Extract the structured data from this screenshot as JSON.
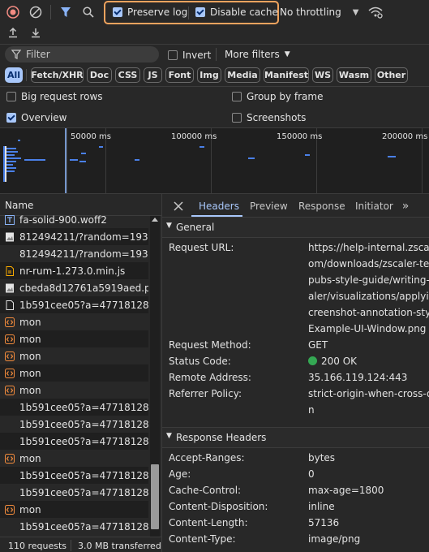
{
  "toolbar": {
    "preserve_log": {
      "label": "Preserve log",
      "checked": true
    },
    "disable_cache": {
      "label": "Disable cache",
      "checked": true
    },
    "throttling": "No throttling",
    "highlight_color": "#f0a35e"
  },
  "filter": {
    "placeholder": "Filter",
    "invert_label": "Invert",
    "more_filters_label": "More filters",
    "types": [
      "All",
      "Fetch/XHR",
      "Doc",
      "CSS",
      "JS",
      "Font",
      "Img",
      "Media",
      "Manifest",
      "WS",
      "Wasm",
      "Other"
    ],
    "active_type": "All"
  },
  "options": {
    "big_request_rows": {
      "label": "Big request rows",
      "checked": false
    },
    "group_by_frame": {
      "label": "Group by frame",
      "checked": false
    },
    "overview": {
      "label": "Overview",
      "checked": true
    },
    "screenshots": {
      "label": "Screenshots",
      "checked": false
    }
  },
  "timeline": {
    "ticks": [
      "50000 ms",
      "100000 ms",
      "150000 ms",
      "200000 ms"
    ]
  },
  "request_list": {
    "column_name": "Name",
    "rows": [
      {
        "name": "fa-solid-900.woff2",
        "icon": "font-icon"
      },
      {
        "name": "812494211/?random=1934...",
        "icon": "image-icon"
      },
      {
        "name": "812494211/?random=1934...",
        "icon": "none"
      },
      {
        "name": "nr-rum-1.273.0.min.js",
        "icon": "script-icon"
      },
      {
        "name": "cbeda8d12761a5919aed.png",
        "icon": "image-icon"
      },
      {
        "name": "1b591cee05?a=477181280...",
        "icon": "document-icon"
      },
      {
        "name": "mon",
        "icon": "xhr-icon"
      },
      {
        "name": "mon",
        "icon": "xhr-icon"
      },
      {
        "name": "mon",
        "icon": "xhr-icon"
      },
      {
        "name": "mon",
        "icon": "xhr-icon"
      },
      {
        "name": "mon",
        "icon": "xhr-icon"
      },
      {
        "name": "1b591cee05?a=477181280...",
        "icon": "none"
      },
      {
        "name": "1b591cee05?a=477181280...",
        "icon": "none"
      },
      {
        "name": "1b591cee05?a=477181280...",
        "icon": "none"
      },
      {
        "name": "mon",
        "icon": "xhr-icon"
      },
      {
        "name": "1b591cee05?a=477181280...",
        "icon": "none"
      },
      {
        "name": "1b591cee05?a=477181280...",
        "icon": "none"
      },
      {
        "name": "mon",
        "icon": "xhr-icon"
      },
      {
        "name": "1b591cee05?a=477181280...",
        "icon": "none"
      }
    ]
  },
  "status_bar": {
    "requests": "110 requests",
    "transferred": "3.0 MB transferred"
  },
  "detail": {
    "tabs": [
      "Headers",
      "Preview",
      "Response",
      "Initiator"
    ],
    "active_tab": "Headers",
    "general": {
      "title": "General",
      "request_url_label": "Request URL:",
      "request_url_lines": [
        "https://help-internal.zscaler.c",
        "om/downloads/zscaler-tech-",
        "pubs-style-guide/writing-zsc",
        "aler/visualizations/applying-",
        "creenshot-annotation-styles-",
        "Example-UI-Window.png"
      ],
      "request_method_label": "Request Method:",
      "request_method": "GET",
      "status_code_label": "Status Code:",
      "status_code": "200 OK",
      "remote_address_label": "Remote Address:",
      "remote_address": "35.166.119.124:443",
      "referrer_policy_label": "Referrer Policy:",
      "referrer_policy_lines": [
        "strict-origin-when-cross-origi",
        "n"
      ]
    },
    "response_headers": {
      "title": "Response Headers",
      "items": [
        {
          "key": "Accept-Ranges:",
          "value": "bytes"
        },
        {
          "key": "Age:",
          "value": "0"
        },
        {
          "key": "Cache-Control:",
          "value": "max-age=1800"
        },
        {
          "key": "Content-Disposition:",
          "value": "inline"
        },
        {
          "key": "Content-Length:",
          "value": "57136"
        },
        {
          "key": "Content-Type:",
          "value": "image/png"
        }
      ]
    }
  }
}
